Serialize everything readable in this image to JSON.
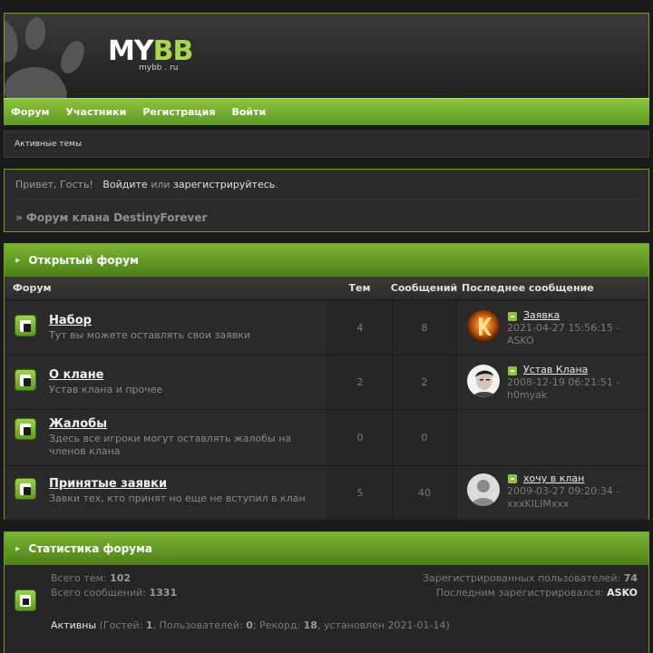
{
  "logo": {
    "text_a": "MY",
    "text_b": "BB",
    "sub": "mybb . ru"
  },
  "nav": [
    "Форум",
    "Участники",
    "Регистрация",
    "Войти"
  ],
  "subbar": {
    "active_topics": "Активные темы"
  },
  "welcome": {
    "greet": "Привет, Гость!",
    "login": "Войдите",
    "or": "или",
    "register": "зарегистрируйтесь",
    "period": ".",
    "crumb": "» Форум клана DestinyForever"
  },
  "category": {
    "title": "Открытый форум",
    "columns": {
      "forum": "Форум",
      "topics": "Тем",
      "posts": "Сообщений",
      "last": "Последнее сообщение"
    },
    "forums": [
      {
        "name": "Набор",
        "desc": "Тут вы можете оставлять свои заявки",
        "topics": "4",
        "posts": "8",
        "last": {
          "title": "Заявка",
          "date": "2021-04-27 15:56:15 -",
          "author": "ASKO",
          "avatar": "orange-k"
        }
      },
      {
        "name": "О клане",
        "desc": "Устав клана и прочее",
        "topics": "2",
        "posts": "2",
        "last": {
          "title": "Устав Клана",
          "date": "2008-12-19 06:21:51 -",
          "author": "h0myak",
          "avatar": "photo"
        }
      },
      {
        "name": "Жалобы",
        "desc": "Здесь все игроки могут оставлять жалобы на членов клана",
        "topics": "0",
        "posts": "0",
        "last": null
      },
      {
        "name": "Принятые заявки",
        "desc": "Завки тех, кто принят но еще не вступил в клан",
        "topics": "5",
        "posts": "40",
        "last": {
          "title": "хочу в клан",
          "date": "2009-03-27 09:20:34 -",
          "author": "xxxKILIMxxx",
          "avatar": "default"
        }
      }
    ]
  },
  "stats": {
    "title": "Статистика форума",
    "total_topics_label": "Всего тем:",
    "total_topics": "102",
    "total_posts_label": "Всего сообщений:",
    "total_posts": "1331",
    "registered_label": "Зарегистрированных пользователей:",
    "registered": "74",
    "last_reg_label": "Последним зарегистрировался:",
    "last_reg": "ASKO",
    "online_link": "Активны",
    "online_text_1": " (Гостей: ",
    "guests": "1",
    "online_text_2": ", Пользователей: ",
    "users": "0",
    "online_text_3": "; Рекорд: ",
    "record": "18",
    "online_text_4": ", установлен 2021-01-14)"
  },
  "colors": {
    "accent": "#7cb534",
    "bg": "#1a1a1a"
  }
}
